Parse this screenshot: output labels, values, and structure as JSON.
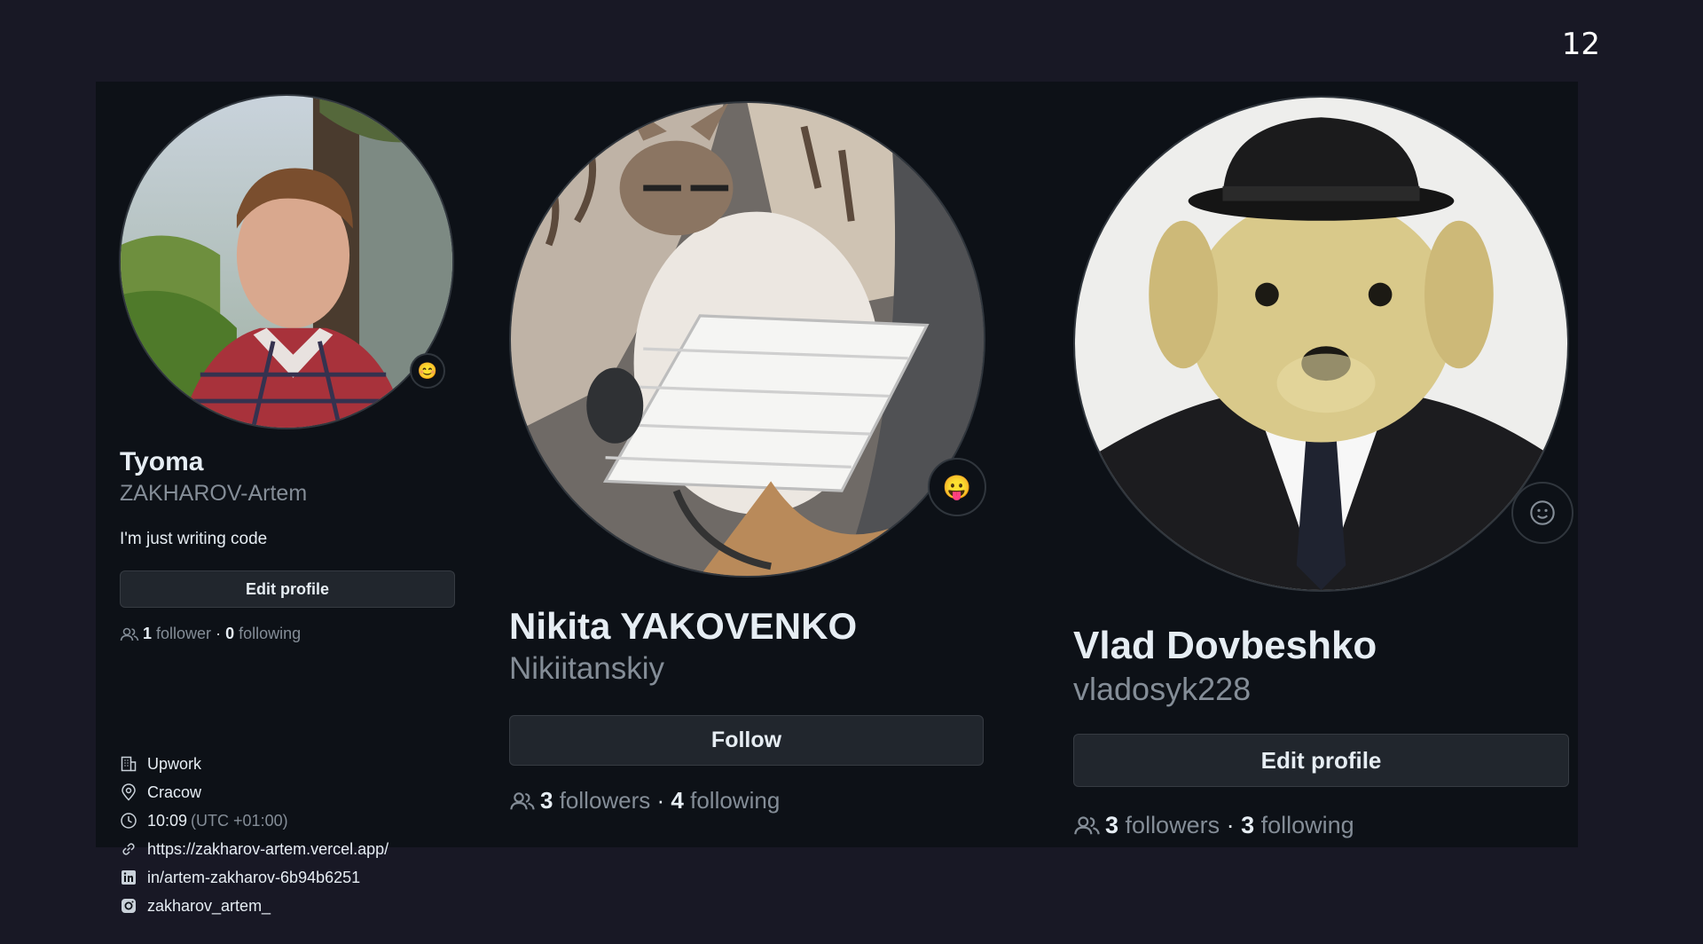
{
  "slide_number": "12",
  "profiles": [
    {
      "name": "Tyoma",
      "login": "ZAKHAROV-Artem",
      "bio": "I'm just writing code",
      "button": "Edit profile",
      "followers_count": "1",
      "followers_label": "follower",
      "following_count": "0",
      "following_label": "following",
      "status_emoji": "😊",
      "details": {
        "company": "Upwork",
        "location": "Cracow",
        "time": "10:09",
        "timezone": "(UTC +01:00)",
        "website": "https://zakharov-artem.vercel.app/",
        "linkedin": "in/artem-zakharov-6b94b6251",
        "instagram": "zakharov_artem_"
      }
    },
    {
      "name": "Nikita YAKOVENKO",
      "login": "Nikiitanskiy",
      "button": "Follow",
      "followers_count": "3",
      "followers_label": "followers",
      "following_count": "4",
      "following_label": "following",
      "status_emoji": "😛"
    },
    {
      "name": "Vlad Dovbeshko",
      "login": "vladosyk228",
      "button": "Edit profile",
      "followers_count": "3",
      "followers_label": "followers",
      "following_count": "3",
      "following_label": "following",
      "status_emoji": "smiley-outline-icon"
    }
  ],
  "colors": {
    "background": "#181825",
    "panel": "#0d1117",
    "text": "#e6edf3",
    "muted": "#848d97",
    "button": "#21262d"
  }
}
